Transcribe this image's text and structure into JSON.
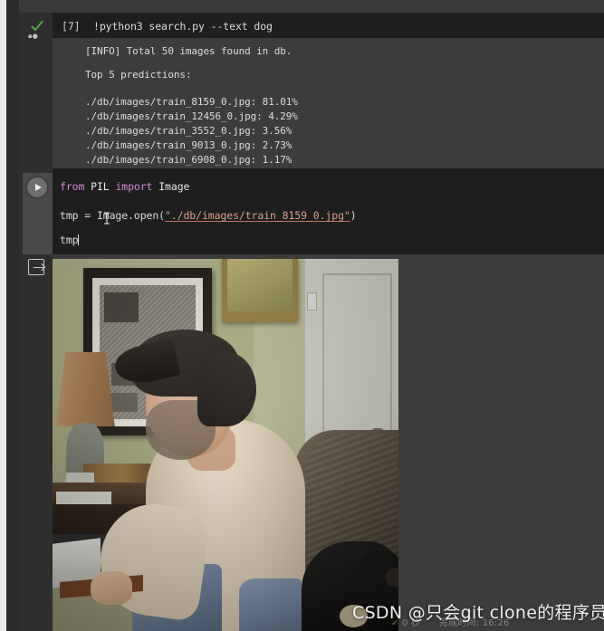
{
  "app": {
    "theme_bg": "#1e1e1e",
    "output_bg": "#3c3c3c",
    "gutter_bg": "#2e2e2e"
  },
  "cells": [
    {
      "prompt": "[7]",
      "command": "!python3 search.py --text dog",
      "status_icon": "check-icon",
      "output_lines": [
        "[INFO] Total 50 images found in db.",
        "",
        "Top 5 predictions:",
        "",
        "./db/images/train_8159_0.jpg: 81.01%",
        "./db/images/train_12456_0.jpg: 4.29%",
        "./db/images/train_3552_0.jpg: 3.56%",
        "./db/images/train_9013_0.jpg: 2.73%",
        "./db/images/train_6908_0.jpg: 1.17%"
      ],
      "predictions": [
        {
          "path": "./db/images/train_8159_0.jpg",
          "score": "81.01%"
        },
        {
          "path": "./db/images/train_12456_0.jpg",
          "score": "4.29%"
        },
        {
          "path": "./db/images/train_3552_0.jpg",
          "score": "3.56%"
        },
        {
          "path": "./db/images/train_9013_0.jpg",
          "score": "2.73%"
        },
        {
          "path": "./db/images/train_6908_0.jpg",
          "score": "1.17%"
        }
      ],
      "info_total": "50"
    },
    {
      "prompt": "",
      "status_icon": "check-icon",
      "run_button": "run-cell-button",
      "code": {
        "line1_kw1": "from",
        "line1_mod": "PIL",
        "line1_kw2": "import",
        "line1_name": "Image",
        "line2_pre": "tmp = Image.open(",
        "line2_str": "\"./db/images/train_8159_0.jpg\"",
        "line2_post": ")",
        "line3": "tmp"
      }
    }
  ],
  "output_image": {
    "icon": "output-export-icon",
    "alt": "photo of a man in a dark baseball cap and tan sweater typing on a laptop, with a black dog beside him"
  },
  "watermark": {
    "text": "CSDN @只会git clone的程序员"
  },
  "status": {
    "check": "✓",
    "duration": "0 秒",
    "completed_label": "完成时间:",
    "completed_time": "16:26"
  }
}
